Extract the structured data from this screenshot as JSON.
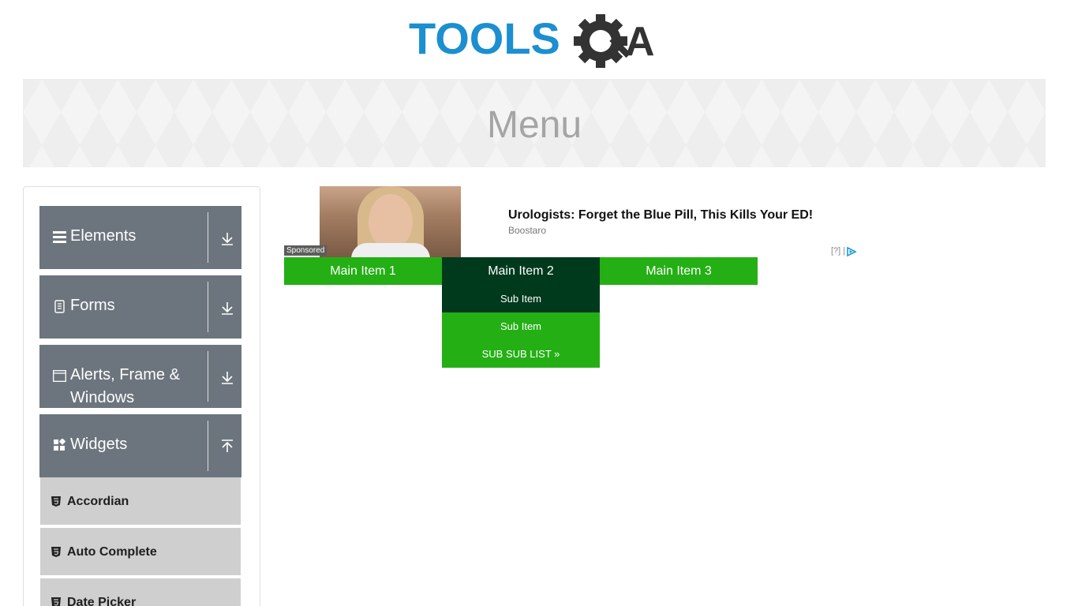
{
  "logo": {
    "part1": "TOOLS",
    "part2": "A",
    "colors": {
      "tools": "#1b8fd0",
      "gear": "#333333"
    }
  },
  "banner": {
    "title": "Menu"
  },
  "sidebar": {
    "groups": [
      {
        "label": "Elements",
        "icon": "hamburger-icon",
        "arrow": "download-icon"
      },
      {
        "label": "Forms",
        "icon": "document-icon",
        "arrow": "download-icon"
      },
      {
        "label": "Alerts, Frame & Windows",
        "icon": "window-icon",
        "arrow": "download-icon"
      },
      {
        "label": "Widgets",
        "icon": "widgets-icon",
        "arrow": "upload-icon"
      }
    ],
    "items": [
      {
        "label": "Accordian",
        "icon": "html5-icon"
      },
      {
        "label": "Auto Complete",
        "icon": "html5-icon"
      },
      {
        "label": "Date Picker",
        "icon": "html5-icon"
      }
    ]
  },
  "ad": {
    "sponsored": "Sponsored",
    "title": "Urologists: Forget the Blue Pill, This Kills Your ED!",
    "source": "Boostaro",
    "info": "[?] |"
  },
  "menu": {
    "main_items": [
      "Main Item 1",
      "Main Item 2",
      "Main Item 3"
    ],
    "sub_items": [
      "Sub Item",
      "Sub Item",
      "SUB SUB LIST »"
    ],
    "colors": {
      "item": "#24af15",
      "hover": "#003a1d"
    }
  }
}
